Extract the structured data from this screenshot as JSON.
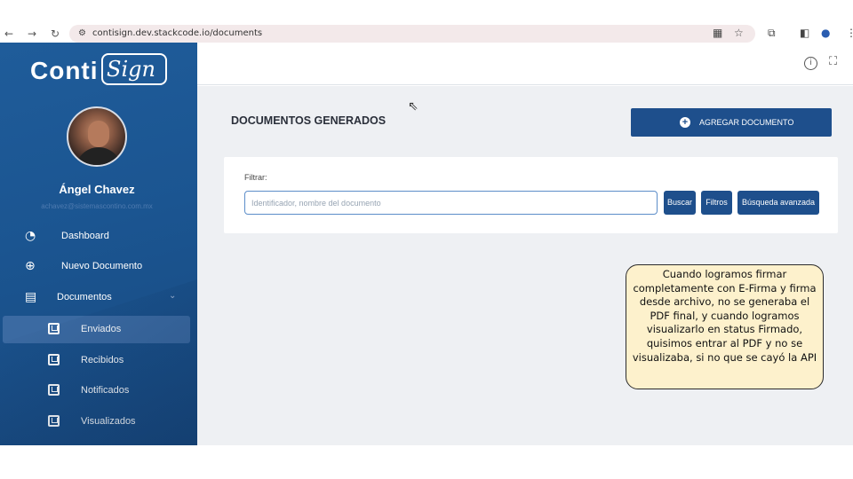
{
  "browser": {
    "back_icon": "arrow-left-icon",
    "forward_icon": "arrow-right-icon",
    "reload_icon": "reload-icon",
    "url": "contisign.dev.stackcode.io/documents"
  },
  "sidebar": {
    "logo_conti": "Conti",
    "logo_sign": "Sign",
    "user_name": "Ángel Chavez",
    "user_email": "achavez@sistemascontino.com.mx",
    "menu": [
      {
        "label": "Dashboard",
        "icon": "pie-chart-icon"
      },
      {
        "label": "Nuevo Documento",
        "icon": "plus-circle-icon"
      },
      {
        "label": "Documentos",
        "icon": "document-icon"
      }
    ],
    "submenu": [
      {
        "label": "Enviados",
        "active": true
      },
      {
        "label": "Recibidos",
        "active": false
      },
      {
        "label": "Notificados",
        "active": false
      },
      {
        "label": "Visualizados",
        "active": false
      }
    ]
  },
  "main": {
    "page_title": "DOCUMENTOS GENERADOS",
    "add_button": "AGREGAR DOCUMENTO",
    "filter_label": "Filtrar:",
    "filter_placeholder": "Identificador, nombre del documento",
    "search_button": "Buscar",
    "filters_button": "Filtros",
    "advanced_button": "Búsqueda avanzada"
  },
  "callout": {
    "text": "Cuando logramos firmar completamente con E-Firma y firma desde archivo, no se generaba el PDF final, y cuando logramos visualizarlo en status Firmado, quisimos entrar al PDF y no se visualizaba, si no que se cayó la API"
  },
  "colors": {
    "sidebar": "#1b5591",
    "primary_button": "#1e4f8c",
    "callout_bg": "#fdf1cc"
  }
}
